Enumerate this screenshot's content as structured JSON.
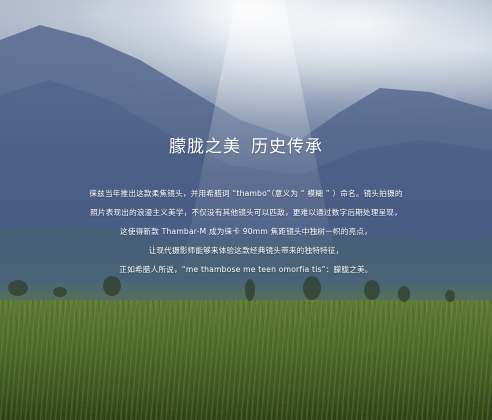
{
  "hero": {
    "title_part1": "朦胧之美",
    "title_part2": "历史传承",
    "lines": [
      "徕兹当年推出这款柔焦镜头，并用希腊词 “thambo”（意义为 “ 模糊 ” ）命名。镜头拍摄的",
      "照片表现出的浪漫主义美学，不仅没有其他镜头可以匹敌，更难以通过数字后期处理呈现，",
      "这使得新款 Thambar-M 成为徕卡 90mm 焦距镜头中独树一帜的亮点，",
      "让现代摄影师能够来体验这款经典镜头带来的独特特征，",
      "正如希腊人所说，“me thambose me teen omorfia tis”：朦胧之美。"
    ]
  },
  "colors": {
    "text": "#ffffff",
    "sky": "#7f90ab",
    "grass": "#4d6a2c"
  }
}
